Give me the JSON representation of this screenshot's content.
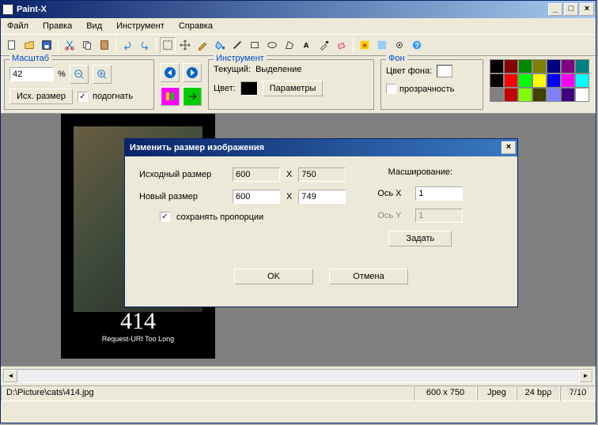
{
  "app": {
    "title": "Paint-X"
  },
  "menu": {
    "file": "Файл",
    "edit": "Правка",
    "view": "Вид",
    "tool": "Инструмент",
    "help": "Справка"
  },
  "scale": {
    "legend": "Масштаб",
    "value": "42",
    "pct": "%",
    "reset": "Исх. размер",
    "fit": "подогнать"
  },
  "tool": {
    "legend": "Инструмент",
    "current_lbl": "Текущий:",
    "current_val": "Выделение",
    "color_lbl": "Цвет:",
    "params": "Параметры"
  },
  "bg": {
    "legend": "Фон",
    "color_lbl": "Цвет фона:",
    "trans": "прозрачность"
  },
  "image": {
    "code": "414",
    "msg": "Request-URI Too Long"
  },
  "dialog": {
    "title": "Изменить размер изображения",
    "src_lbl": "Исходный размер",
    "src_w": "600",
    "src_h": "750",
    "new_lbl": "Новый размер",
    "new_w": "600",
    "new_h": "749",
    "x_sep": "X",
    "keep": "сохранять пропорции",
    "scaling_lbl": "Масширование:",
    "axis_x": "Ось X",
    "axis_y": "Ось Y",
    "sx": "1",
    "sy": "1",
    "set": "Задать",
    "ok": "OK",
    "cancel": "Отмена"
  },
  "status": {
    "path": "D:\\Picture\\cats\\414.jpg",
    "dims": "600 x 750",
    "fmt": "Jpeg",
    "depth": "24 bpp",
    "idx": "7/10"
  },
  "palette": [
    [
      "#000",
      "#800",
      "#080",
      "#808000",
      "#000080",
      "#800080",
      "#008080"
    ],
    [
      "#000",
      "#f00",
      "#0f0",
      "#ff0",
      "#00f",
      "#f0f",
      "#0ff"
    ],
    [
      "#808080",
      "#c00000",
      "#80ff00",
      "#404000",
      "#8080ff",
      "#400080",
      "#fff"
    ]
  ],
  "watermark": "ZAV SOFT"
}
